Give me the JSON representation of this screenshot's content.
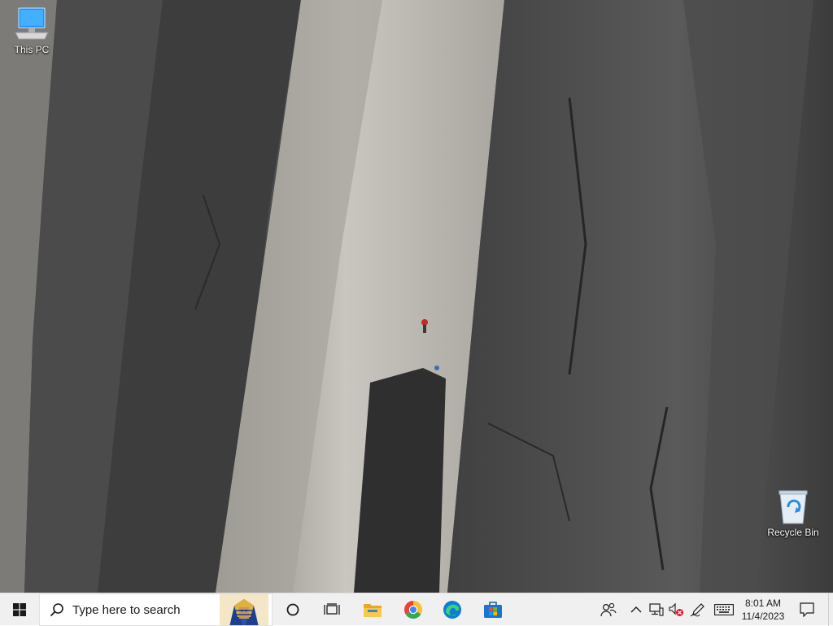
{
  "desktop": {
    "icons": [
      {
        "label": "This PC",
        "icon": "this-pc-icon"
      },
      {
        "label": "Recycle Bin",
        "icon": "recycle-bin-icon"
      }
    ]
  },
  "taskbar": {
    "start_icon": "windows-logo-icon",
    "search": {
      "placeholder": "Type here to search",
      "icon": "search-icon"
    },
    "pinned": [
      {
        "name": "Cortana",
        "icon": "cortana-circle-icon"
      },
      {
        "name": "Task View",
        "icon": "task-view-icon"
      },
      {
        "name": "File Explorer",
        "icon": "folder-icon"
      },
      {
        "name": "Google Chrome",
        "icon": "chrome-icon"
      },
      {
        "name": "Microsoft Edge",
        "icon": "edge-icon"
      },
      {
        "name": "Microsoft Store",
        "icon": "store-icon"
      }
    ],
    "tray": {
      "icons": [
        "people-icon",
        "chevron-up-icon",
        "network-icon",
        "volume-muted-icon",
        "pen-icon",
        "keyboard-icon",
        "notification-icon"
      ],
      "time": "8:01 AM",
      "date": "11/4/2023"
    }
  },
  "colors": {
    "taskbar_bg": "#f0f0f0",
    "windows_blue": "#0078d7",
    "mute_red": "#e81123"
  }
}
